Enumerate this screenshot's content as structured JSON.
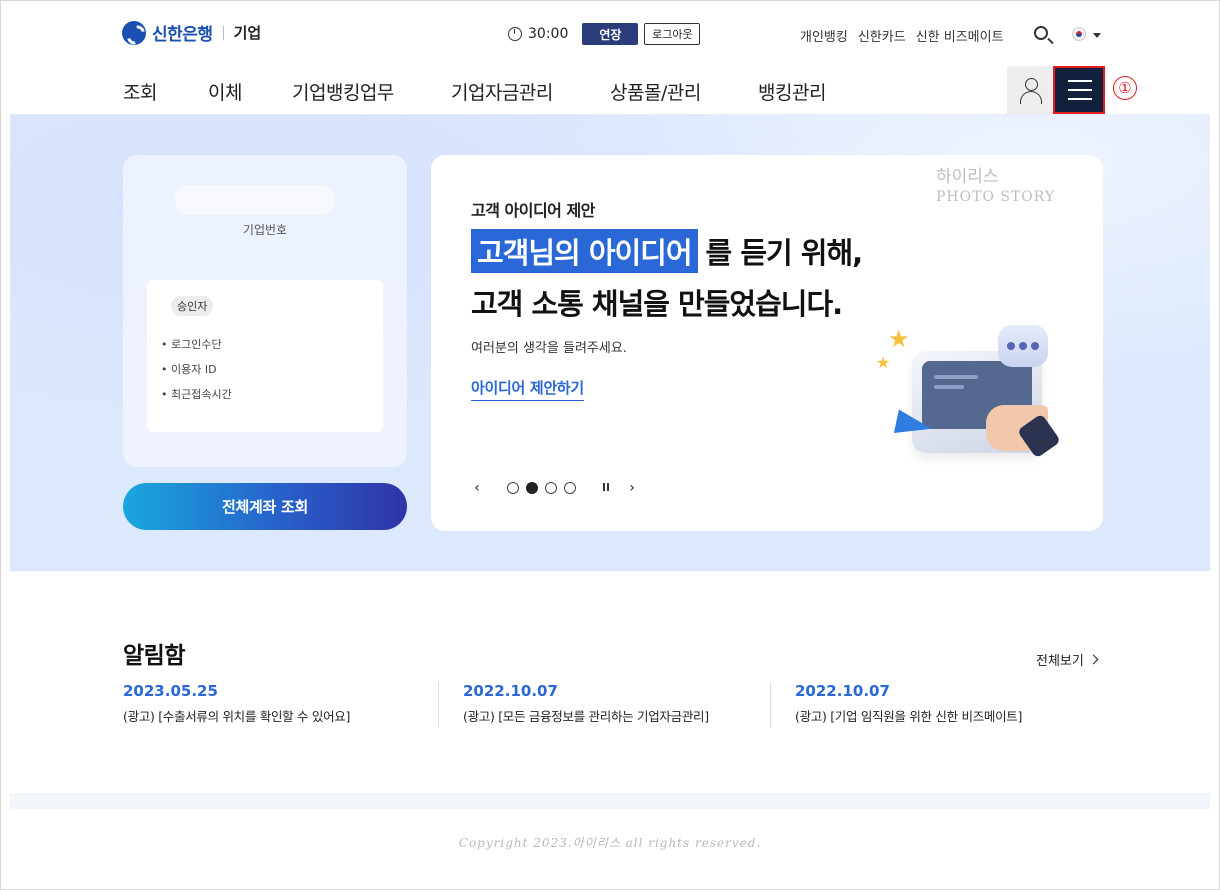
{
  "header": {
    "brand": "신한은행",
    "brand_sub": "기업",
    "timer": "30:00",
    "extend_label": "연장",
    "logout_label": "로그아웃",
    "util_links": [
      "개인뱅킹",
      "신한카드",
      "신한 비즈메이트"
    ]
  },
  "nav": {
    "items": [
      "조회",
      "이체",
      "기업뱅킹업무",
      "기업자금관리",
      "상품몰/관리",
      "뱅킹관리"
    ],
    "menu_annotation": "①"
  },
  "account_card": {
    "number_label": "기업번호",
    "approver_chip": "승인자",
    "fields": [
      "로그인수단",
      "이용자 ID",
      "최근접속시간"
    ],
    "all_accounts_label": "전체계좌 조회"
  },
  "promo": {
    "eyebrow": "고객 아이디어 제안",
    "headline_highlight": "고객님의 아이디어",
    "headline_rest": "를 듣기 위해,",
    "headline_line2": "고객 소통 채널을 만들었습니다.",
    "description": "여러분의 생각을 들려주세요.",
    "link_label": "아이디어 제안하기",
    "watermark_line1": "하이리스",
    "watermark_line2": "PHOTO STORY",
    "active_slide": 2,
    "total_slides": 4
  },
  "notices": {
    "title": "알림함",
    "view_all": "전체보기",
    "items": [
      {
        "date": "2023.05.25",
        "text": "(광고) [수출서류의 위치를 확인할 수 있어요]"
      },
      {
        "date": "2022.10.07",
        "text": "(광고) [모든 금융정보를 관리하는 기업자금관리]"
      },
      {
        "date": "2022.10.07",
        "text": "(광고) [기업 임직원을 위한 신한 비즈메이트]"
      }
    ]
  },
  "footer": {
    "copyright": "Copyright 2023.아이리스 all rights reserved."
  },
  "colors": {
    "brand_blue": "#1b4fb1",
    "accent_blue": "#2968d6",
    "menu_dark": "#14213d",
    "annotation_red": "#e31b23"
  }
}
